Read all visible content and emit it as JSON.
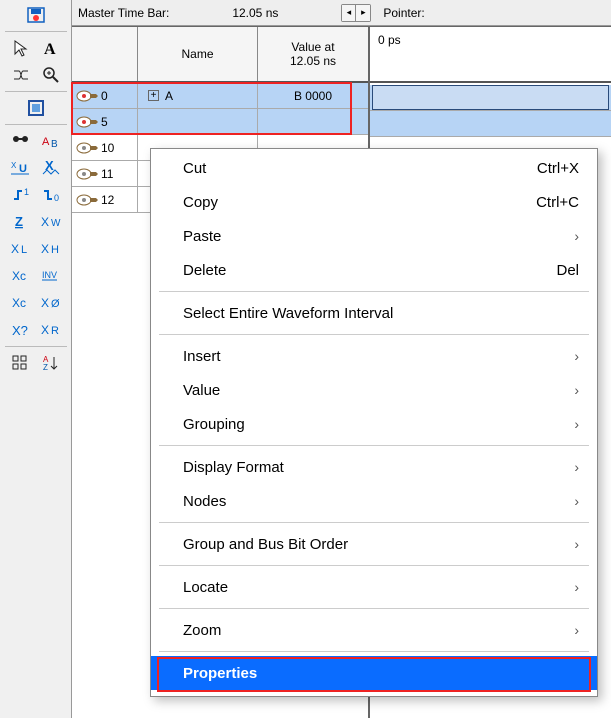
{
  "timebar": {
    "label": "Master Time Bar:",
    "value": "12.05 ns",
    "pointer_label": "Pointer:"
  },
  "sig_header": {
    "name": "Name",
    "value_line1": "Value at",
    "value_line2": "12.05 ns"
  },
  "signals": [
    {
      "idx": "0",
      "name": "A",
      "expand": true,
      "value": "B 0000",
      "selected": true
    },
    {
      "idx": "5",
      "name": "",
      "expand": false,
      "value": "",
      "selected": true
    },
    {
      "idx": "10",
      "name": "",
      "expand": false,
      "value": "",
      "selected": false
    },
    {
      "idx": "11",
      "name": "",
      "expand": false,
      "value": "",
      "selected": false
    },
    {
      "idx": "12",
      "name": "",
      "expand": false,
      "value": "",
      "selected": false
    }
  ],
  "wave_header": {
    "tick0": "0 ps"
  },
  "context_menu": [
    {
      "label": "Cut",
      "shortcut": "Ctrl+X"
    },
    {
      "label": "Copy",
      "shortcut": "Ctrl+C"
    },
    {
      "label": "Paste",
      "submenu": true
    },
    {
      "label": "Delete",
      "shortcut": "Del"
    },
    {
      "sep": true
    },
    {
      "label": "Select Entire Waveform Interval"
    },
    {
      "sep": true
    },
    {
      "label": "Insert",
      "submenu": true
    },
    {
      "label": "Value",
      "submenu": true
    },
    {
      "label": "Grouping",
      "submenu": true
    },
    {
      "sep": true
    },
    {
      "label": "Display Format",
      "submenu": true
    },
    {
      "label": "Nodes",
      "submenu": true
    },
    {
      "sep": true
    },
    {
      "label": "Group and Bus Bit Order",
      "submenu": true
    },
    {
      "sep": true
    },
    {
      "label": "Locate",
      "submenu": true
    },
    {
      "sep": true
    },
    {
      "label": "Zoom",
      "submenu": true
    },
    {
      "sep": true
    },
    {
      "label": "Properties",
      "selected": true
    }
  ]
}
